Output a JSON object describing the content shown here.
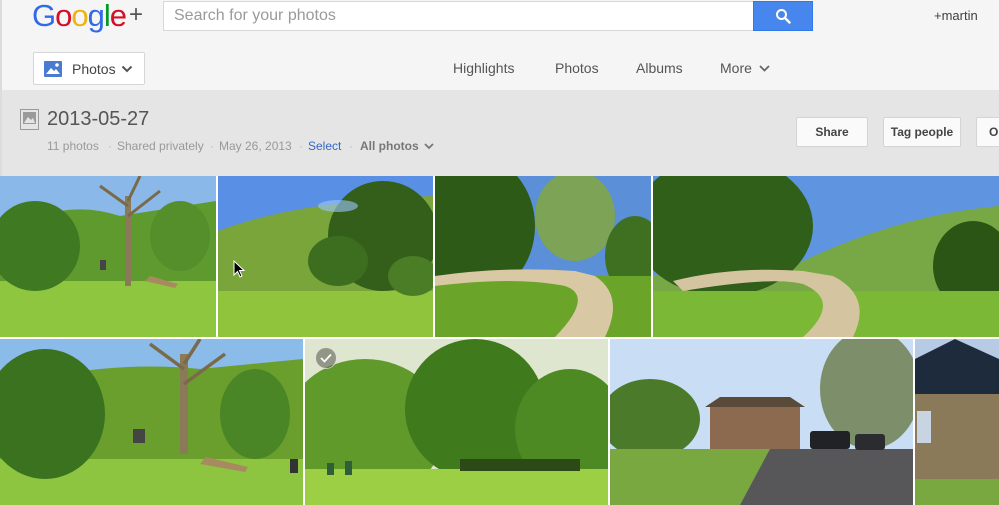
{
  "logo": {
    "letters": [
      {
        "char": "G",
        "color": "#3369e8"
      },
      {
        "char": "o",
        "color": "#d50f25"
      },
      {
        "char": "o",
        "color": "#eeb211"
      },
      {
        "char": "g",
        "color": "#3369e8"
      },
      {
        "char": "l",
        "color": "#009925"
      },
      {
        "char": "e",
        "color": "#d50f25"
      }
    ],
    "suffix": "+"
  },
  "search": {
    "placeholder": "Search for your photos",
    "value": "",
    "icon": "search-icon"
  },
  "user": {
    "name": "+martin"
  },
  "header": {
    "photos_dropdown_label": "Photos",
    "nav": {
      "highlights": "Highlights",
      "photos": "Photos",
      "albums": "Albums",
      "more": "More"
    }
  },
  "album": {
    "title": "2013-05-27",
    "photo_count": "11 photos",
    "sharing": "Shared privately",
    "date": "May 26, 2013",
    "select_label": "Select",
    "filter_label": "All photos",
    "actions": {
      "share": "Share",
      "tag_people": "Tag people",
      "cut_off": "Or"
    }
  },
  "photos": [
    {
      "description": "garden with tree and swing",
      "selected": false
    },
    {
      "description": "grassy hillside with trees",
      "selected": false
    },
    {
      "description": "dirt path between trees",
      "selected": false
    },
    {
      "description": "dirt path and green hillside",
      "selected": false
    },
    {
      "description": "garden with tree and swing",
      "selected": false
    },
    {
      "description": "garden with bushes and chairs",
      "selected": true
    },
    {
      "description": "barn with parked cars",
      "selected": false
    },
    {
      "description": "stone barn with solar panels",
      "selected": false
    }
  ],
  "colors": {
    "accent": "#4787ed",
    "link": "#3366cc",
    "topbar_bg": "#f5f5f5",
    "album_bar_bg": "#e5e5e5"
  }
}
